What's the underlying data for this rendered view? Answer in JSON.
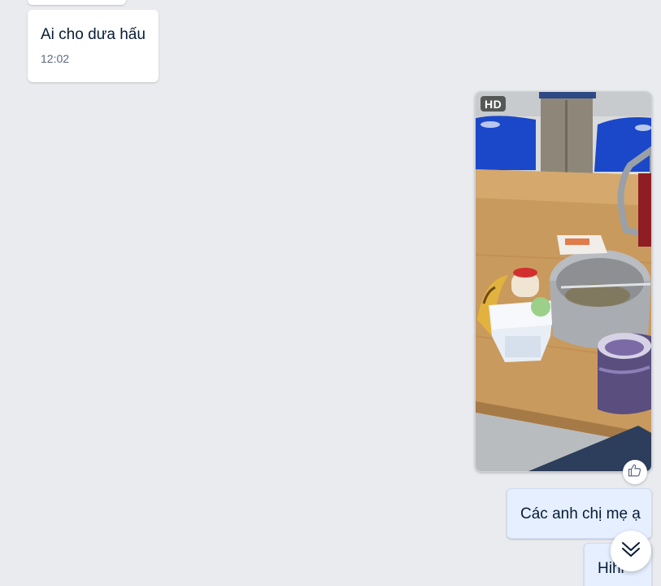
{
  "messages": [
    {
      "id": "dua-hau",
      "direction": "incoming",
      "text": "Ai cho dưa hấu",
      "time": "12:02"
    },
    {
      "id": "photo",
      "direction": "outgoing",
      "type": "image",
      "badge": "HD",
      "image_subject": "table with banana, yogurt cups, steel pot and blue chairs"
    },
    {
      "id": "cac-anh",
      "direction": "outgoing",
      "text": "Các anh chị mẹ ạ"
    },
    {
      "id": "hihi",
      "direction": "outgoing",
      "text": "Hihi"
    }
  ],
  "icons": {
    "reaction": "thumbs-up-icon",
    "scroll": "double-chevron-down-icon"
  },
  "colors": {
    "background": "#e9ebef",
    "incoming_bubble": "#ffffff",
    "outgoing_bubble": "#e5efff",
    "text": "#081c36",
    "time": "#5a6981"
  }
}
